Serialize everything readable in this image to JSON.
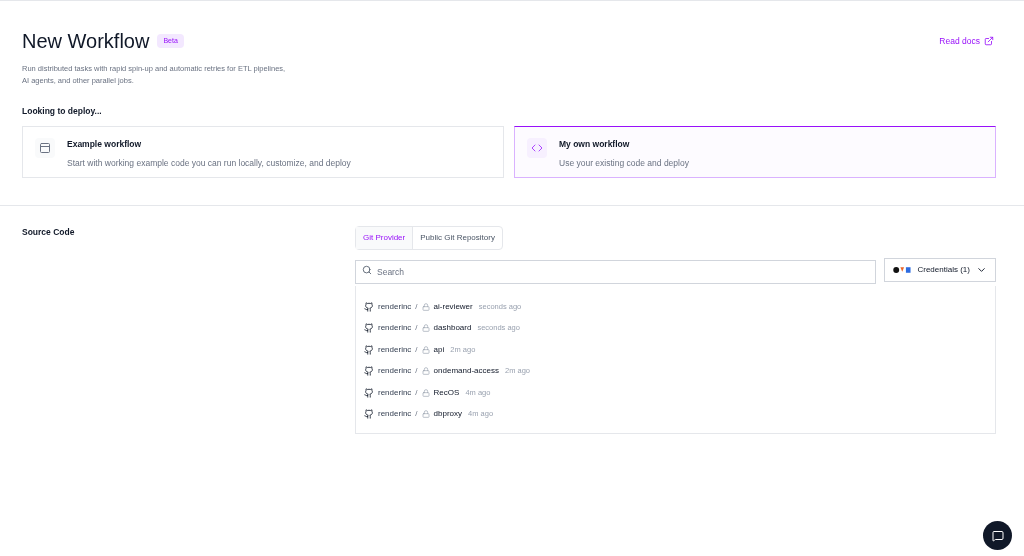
{
  "header": {
    "title": "New Workflow",
    "badge": "Beta",
    "description": "Run distributed tasks with rapid spin-up and automatic retries for ETL pipelines, AI agents, and other parallel jobs.",
    "docs_link": "Read docs"
  },
  "deploy": {
    "label": "Looking to deploy...",
    "options": [
      {
        "kind": "template",
        "title": "Example workflow",
        "description": "Start with working example code you can run locally, customize, and deploy",
        "selected": false
      },
      {
        "kind": "code",
        "title": "My own workflow",
        "description": "Use your existing code and deploy",
        "selected": true
      }
    ]
  },
  "source": {
    "label": "Source Code",
    "tabs": [
      {
        "label": "Git Provider",
        "selected": true
      },
      {
        "label": "Public Git Repository",
        "selected": false
      }
    ],
    "search": {
      "placeholder": "Search"
    },
    "credentials": "Credentials (1)",
    "repos": [
      {
        "owner": "renderinc",
        "separator": "/",
        "name": "ai-reviewer",
        "time": "seconds ago"
      },
      {
        "owner": "renderinc",
        "separator": "/",
        "name": "dashboard",
        "time": "seconds ago"
      },
      {
        "owner": "renderinc",
        "separator": "/",
        "name": "api",
        "time": "2m ago"
      },
      {
        "owner": "renderinc",
        "separator": "/",
        "name": "ondemand-access",
        "time": "2m ago"
      },
      {
        "owner": "renderinc",
        "separator": "/",
        "name": "RecOS",
        "time": "4m ago"
      },
      {
        "owner": "renderinc",
        "separator": "/",
        "name": "dbproxy",
        "time": "4m ago"
      }
    ]
  }
}
